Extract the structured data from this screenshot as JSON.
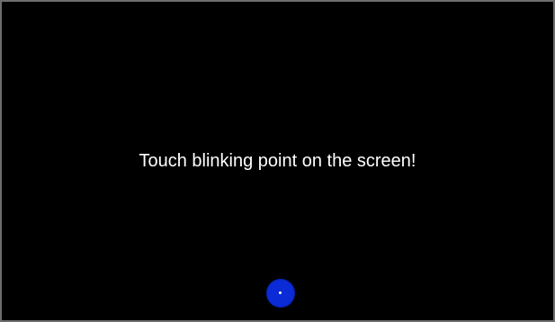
{
  "calibration": {
    "instruction": "Touch blinking point on the screen!",
    "target_icon": "calibration-target-icon",
    "colors": {
      "background": "#000000",
      "text": "#ffffff",
      "target": "#0a2bd6",
      "target_center": "#ffffff",
      "frame_border": "#6e6e6e"
    }
  }
}
